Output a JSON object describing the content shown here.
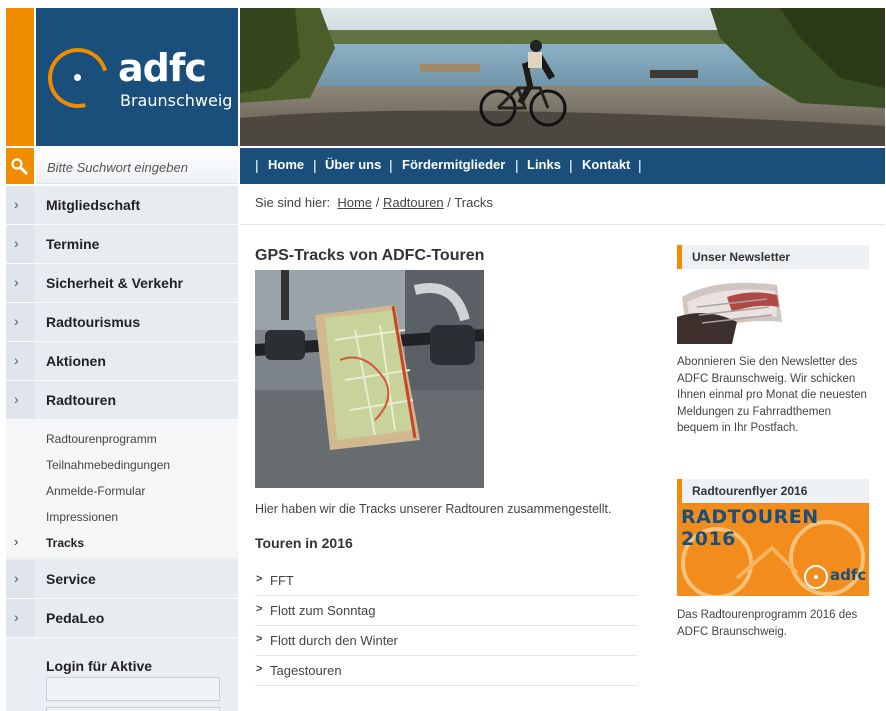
{
  "logo": {
    "word": "adfc",
    "city": "Braunschweig"
  },
  "search": {
    "placeholder": "Bitte Suchwort eingeben"
  },
  "sidebar": {
    "items": [
      {
        "label": "Mitgliedschaft"
      },
      {
        "label": "Termine"
      },
      {
        "label": "Sicherheit & Verkehr"
      },
      {
        "label": "Radtourismus"
      },
      {
        "label": "Aktionen"
      },
      {
        "label": "Radtouren"
      }
    ],
    "subitems": [
      {
        "label": "Radtourenprogramm"
      },
      {
        "label": "Teilnahmebedingungen"
      },
      {
        "label": "Anmelde-Formular"
      },
      {
        "label": "Impressionen"
      },
      {
        "label": "Tracks"
      }
    ],
    "items_after": [
      {
        "label": "Service"
      },
      {
        "label": "PedaLeo"
      }
    ],
    "login_title": "Login für Aktive"
  },
  "topnav": {
    "items": [
      {
        "label": "Home"
      },
      {
        "label": "Über uns"
      },
      {
        "label": "Fördermitglieder"
      },
      {
        "label": "Links"
      },
      {
        "label": "Kontakt"
      }
    ],
    "separator": "|"
  },
  "breadcrumb": {
    "prefix": "Sie sind hier:",
    "home": "Home",
    "sep": "/",
    "parent": "Radtouren",
    "current": "Tracks"
  },
  "main": {
    "title": "GPS-Tracks von ADFC-Touren",
    "intro": "Hier haben wir die Tracks unserer Radtouren zusammengestellt.",
    "section_title": "Touren in 2016",
    "tracks": [
      {
        "label": "FFT"
      },
      {
        "label": "Flott zum Sonntag"
      },
      {
        "label": "Flott durch den Winter"
      },
      {
        "label": "Tagestouren"
      }
    ]
  },
  "widgets": {
    "newsletter": {
      "title": "Unser Newsletter",
      "text": "Abonnieren Sie den Newsletter des ADFC Braunschweig. Wir schicken Ihnen einmal pro Monat die neuesten Meldungen zu Fahrradthemen bequem in Ihr Postfach."
    },
    "flyer": {
      "title": "Radtourenflyer 2016",
      "image_title": "RADTOUREN 2016",
      "image_logo": "adfc",
      "caption": "Das Radtourenprogramm 2016 des ADFC Braunschweig."
    }
  },
  "colors": {
    "brand_blue": "#1a4f7c",
    "brand_orange": "#f08c00",
    "sidebar_bg": "#e7ecf1"
  },
  "icons": {
    "search": "search-icon",
    "chevron": "chevron-right-icon"
  }
}
